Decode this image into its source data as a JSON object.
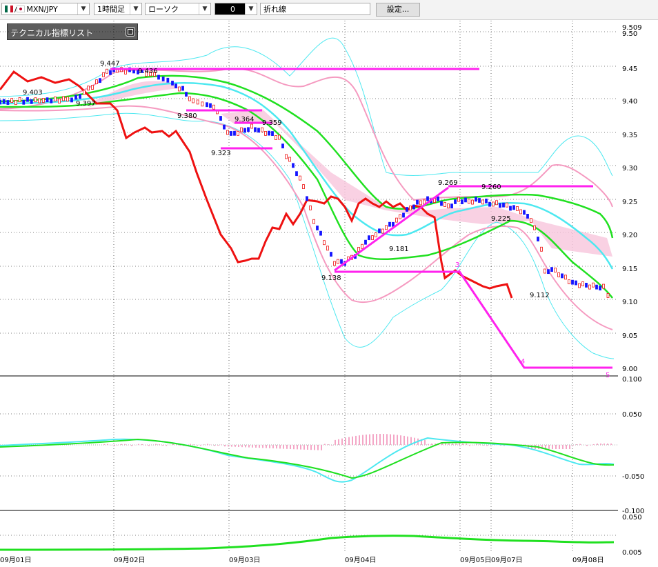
{
  "toolbar": {
    "symbol": "MXN/JPY",
    "timeframe": "1時間足",
    "chart_type": "ローソク",
    "color_value": "0",
    "line_type": "折れ線",
    "settings_label": "設定..."
  },
  "indicator_panel": {
    "title": "テクニカル指標リスト"
  },
  "price_axis": [
    "9.509",
    "9.50",
    "9.45",
    "9.40",
    "9.35",
    "9.30",
    "9.25",
    "9.20",
    "9.15",
    "9.10",
    "9.05",
    "9.00"
  ],
  "macd_axis": [
    "0.100",
    "0.050",
    "-0.050",
    "-0.100"
  ],
  "bottom_axis": [
    "0.050",
    "0.005"
  ],
  "date_labels": [
    "09月01日",
    "09月02日",
    "09月03日",
    "09月04日",
    "09月05日",
    "09月07日",
    "09月08日"
  ],
  "price_annotations": [
    "9.447",
    "9.436",
    "9.403",
    "9.397",
    "9.380",
    "9.364",
    "9.359",
    "9.323",
    "9.269",
    "9.260",
    "9.225",
    "9.181",
    "9.138",
    "9.112"
  ],
  "wave_labels": [
    "3",
    "4",
    "5"
  ],
  "colors": {
    "bollinger": "#4de8f0",
    "bollinger_outer": "#f59ac0",
    "moving_average": "#20e020",
    "red_line": "#ee1111",
    "magenta": "#ff22ee",
    "cloud": "#f8c6dc"
  },
  "chart_data": {
    "type": "line",
    "ylim": [
      9.0,
      9.509
    ],
    "x": [
      "09月01日",
      "09月02日",
      "09月03日",
      "09月04日",
      "09月05日",
      "09月07日",
      "09月08日"
    ],
    "series": [
      {
        "name": "",
        "values": [
          9.4,
          9.43,
          9.35,
          9.14,
          9.26,
          9.22,
          9.1
        ]
      }
    ]
  }
}
